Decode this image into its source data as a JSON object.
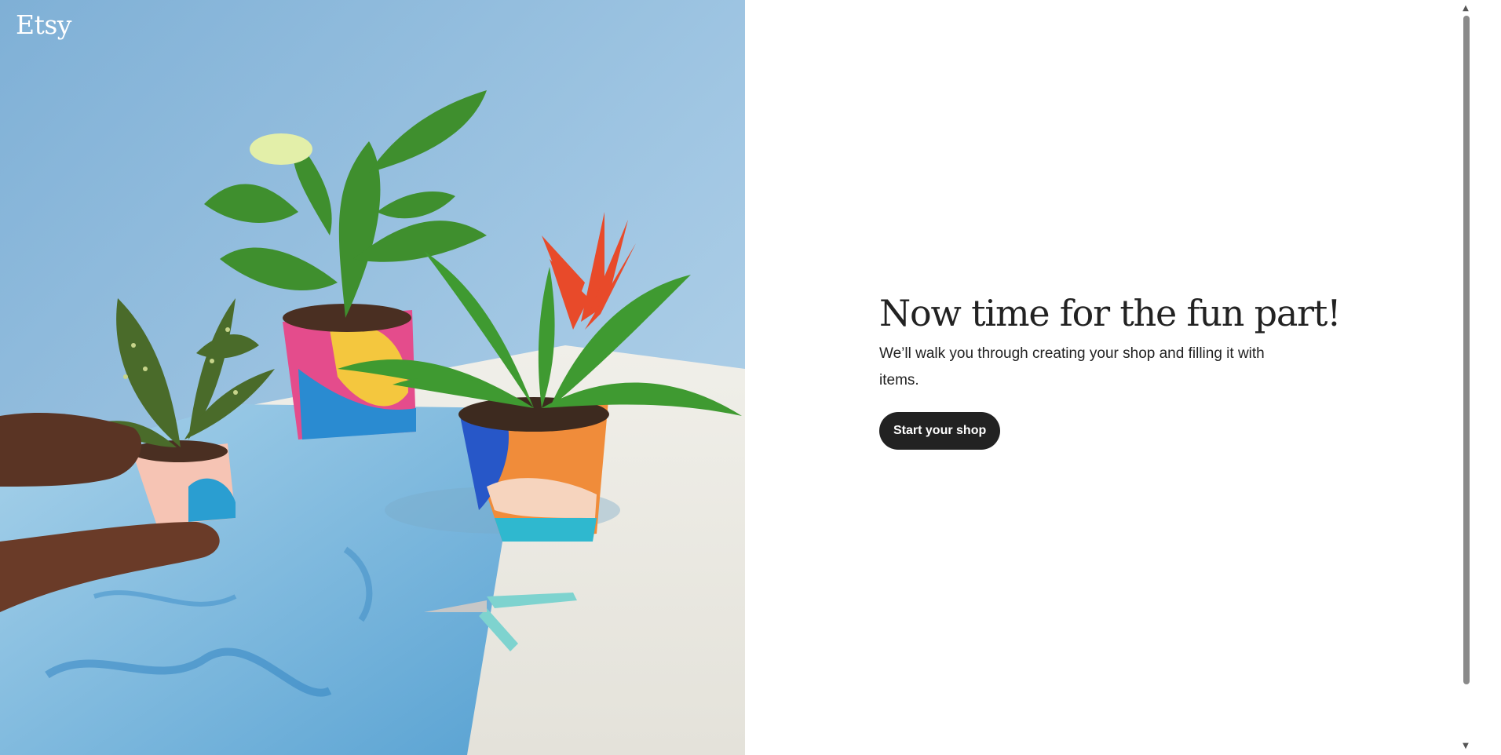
{
  "brand": {
    "logo_text": "Etsy"
  },
  "hero": {
    "image_icon": "plants-photo"
  },
  "main": {
    "headline": "Now time for the fun part!",
    "subtext": "We’ll walk you through creating your shop and filling it with items.",
    "cta_label": "Start your shop"
  },
  "scrollbar": {
    "up_arrow": "▲",
    "down_arrow": "▼"
  },
  "colors": {
    "cta_background": "#222222",
    "cta_text": "#ffffff",
    "headline": "#222222",
    "page_background": "#ffffff"
  }
}
